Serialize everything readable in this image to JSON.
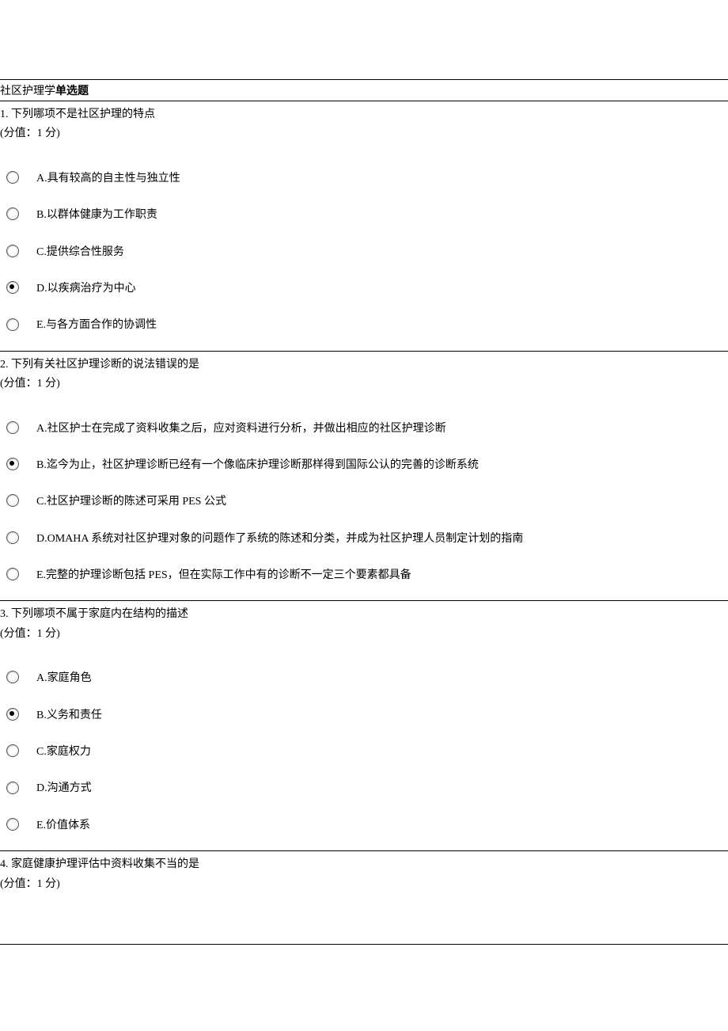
{
  "header": {
    "prefix": "社区护理学",
    "suffix": "单选题"
  },
  "questions": [
    {
      "number": "1.",
      "text": "下列哪项不是社区护理的特点",
      "score": "(分值：1 分)",
      "selected_index": 3,
      "options": [
        "A.具有较高的自主性与独立性",
        "B.以群体健康为工作职责",
        "C.提供综合性服务",
        "D.以疾病治疗为中心",
        "E.与各方面合作的协调性"
      ]
    },
    {
      "number": "2.",
      "text": "下列有关社区护理诊断的说法错误的是",
      "score": "(分值：1 分)",
      "selected_index": 1,
      "options": [
        "A.社区护士在完成了资料收集之后，应对资料进行分析，并做出相应的社区护理诊断",
        "B.迄今为止，社区护理诊断已经有一个像临床护理诊断那样得到国际公认的完善的诊断系统",
        "C.社区护理诊断的陈述可采用 PES 公式",
        "D.OMAHA 系统对社区护理对象的问题作了系统的陈述和分类，并成为社区护理人员制定计划的指南",
        "E.完整的护理诊断包括 PES，但在实际工作中有的诊断不一定三个要素都具备"
      ]
    },
    {
      "number": "3.",
      "text": "下列哪项不属于家庭内在结构的描述",
      "score": "(分值：1 分)",
      "selected_index": 1,
      "options": [
        "A.家庭角色",
        "B.义务和责任",
        "C.家庭权力",
        "D.沟通方式",
        "E.价值体系"
      ]
    },
    {
      "number": "4.",
      "text": "家庭健康护理评估中资料收集不当的是",
      "score": "(分值：1 分)",
      "selected_index": -1,
      "options": []
    }
  ]
}
